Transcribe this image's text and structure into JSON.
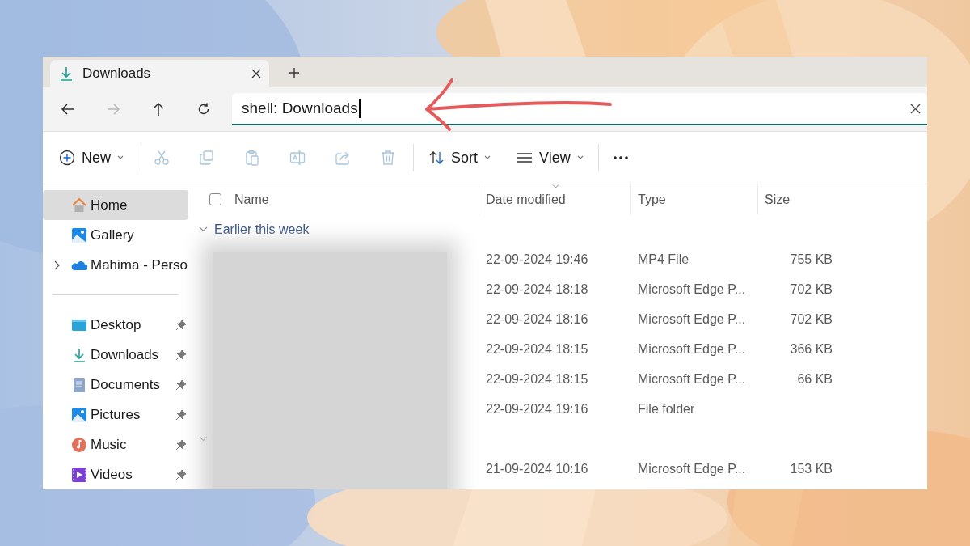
{
  "tab": {
    "title": "Downloads",
    "selected": true
  },
  "nav": [
    {
      "disabled": false
    },
    {
      "disabled": true
    },
    {
      "disabled": false
    },
    {
      "disabled": false
    }
  ],
  "address": {
    "value": "shell: Downloads"
  },
  "toolbar": {
    "new_label": "New",
    "actions": [
      {
        "disabled": true
      },
      {
        "disabled": true
      },
      {
        "disabled": true
      },
      {
        "disabled": true
      },
      {
        "disabled": true
      },
      {
        "disabled": true
      }
    ],
    "sort_label": "Sort",
    "view_label": "View"
  },
  "sidebar": {
    "top": [
      {
        "label": "Home",
        "selected": true,
        "expandable": false
      },
      {
        "label": "Gallery",
        "selected": false,
        "expandable": false
      },
      {
        "label": "Mahima - Perso",
        "selected": false,
        "expandable": true
      }
    ],
    "quick_access": [
      {
        "label": "Desktop",
        "selected": false,
        "pinned": true
      },
      {
        "label": "Downloads",
        "selected": false,
        "pinned": true
      },
      {
        "label": "Documents",
        "selected": false,
        "pinned": true
      },
      {
        "label": "Pictures",
        "selected": false,
        "pinned": true
      },
      {
        "label": "Music",
        "selected": false,
        "pinned": true
      },
      {
        "label": "Videos",
        "selected": false,
        "pinned": true
      }
    ]
  },
  "table": {
    "select_all": {
      "checked": false
    },
    "columns": [
      {
        "label": "Name",
        "sorted": false
      },
      {
        "label": "Date modified",
        "sorted": true
      },
      {
        "label": "Type",
        "sorted": false
      },
      {
        "label": "Size",
        "sorted": false
      }
    ],
    "groups": [
      {
        "label": "Earlier this week",
        "rows": [
          {
            "date": "22-09-2024 19:46",
            "type": "MP4 File",
            "size": "755 KB"
          },
          {
            "date": "22-09-2024 18:18",
            "type": "Microsoft Edge P...",
            "size": "702 KB"
          },
          {
            "date": "22-09-2024 18:16",
            "type": "Microsoft Edge P...",
            "size": "702 KB"
          },
          {
            "date": "22-09-2024 18:15",
            "type": "Microsoft Edge P...",
            "size": "366 KB"
          },
          {
            "date": "22-09-2024 18:15",
            "type": "Microsoft Edge P...",
            "size": "66 KB"
          },
          {
            "date": "22-09-2024 19:16",
            "type": "File folder"
          }
        ]
      },
      {
        "rows": [
          {
            "date": "21-09-2024 10:16",
            "type": "Microsoft Edge P...",
            "size": "153 KB"
          }
        ]
      }
    ]
  }
}
